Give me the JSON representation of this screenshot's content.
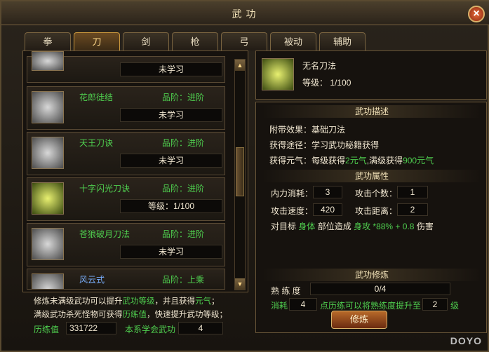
{
  "window": {
    "title": "武功"
  },
  "tabs": [
    {
      "label": "拳"
    },
    {
      "label": "刀"
    },
    {
      "label": "剑"
    },
    {
      "label": "枪"
    },
    {
      "label": "弓"
    },
    {
      "label": "被动"
    },
    {
      "label": "辅助"
    }
  ],
  "skills": [
    {
      "name": "",
      "grade": "",
      "status": "未学习"
    },
    {
      "name": "花郎徒结",
      "grade": "品阶：进阶",
      "status": "未学习"
    },
    {
      "name": "天王刀诀",
      "grade": "品阶：进阶",
      "status": "未学习"
    },
    {
      "name": "十字闪光刀诀",
      "grade": "品阶：进阶",
      "status": "等级：1/100"
    },
    {
      "name": "苍狼破月刀法",
      "grade": "品阶：进阶",
      "status": "未学习"
    },
    {
      "name": "风云式",
      "grade": "品阶：上乘",
      "status": ""
    }
  ],
  "bottom_left": {
    "tip1": "修炼未满级武功可以提升",
    "tip1_green1": "武功等级",
    "tip1_b": "，并且获得",
    "tip1_green2": "元气",
    "tip1_end": "；",
    "tip2": "满级武功杀死怪物可获得",
    "tip2_green": "历练值",
    "tip2_end": "，快速提升武功等级；",
    "exp_label": "历练值",
    "exp_value": "331722",
    "learned_label": "本系学会武功",
    "learned_value": "4"
  },
  "detail": {
    "name": "无名刀法",
    "level": "等级：  1/100",
    "desc_header": "武功描述",
    "effect_label": "附带效果：",
    "effect_value": "基础刀法",
    "source_label": "获得途径：",
    "source_value": "学习武功秘籍获得",
    "qi_label": "获得元气：",
    "qi_a": "每级获得",
    "qi_b": "2元气",
    "qi_c": ",满级获得",
    "qi_d": "900元气",
    "attr_header": "武功属性",
    "mp_label": "内力消耗：",
    "mp_value": "3",
    "count_label": "攻击个数：",
    "count_value": "1",
    "speed_label": "攻击速度：",
    "speed_value": "420",
    "dist_label": "攻击距离：",
    "dist_value": "2",
    "target_a": "对目标",
    "target_b": "身体",
    "target_c": "部位造成",
    "target_d": "身攻 *88% + 0.8",
    "target_e": "伤害",
    "train_header": "武功修炼",
    "prof_label": "熟 练 度",
    "prof_value": "0/4",
    "prof_fraction": 0.0,
    "cost_label": "消耗",
    "cost_value": "4",
    "cost_text": "点历练可以将熟练度提升至",
    "cost_target": "2",
    "cost_unit": "级",
    "train_button": "修炼"
  },
  "watermark": "DOYO"
}
